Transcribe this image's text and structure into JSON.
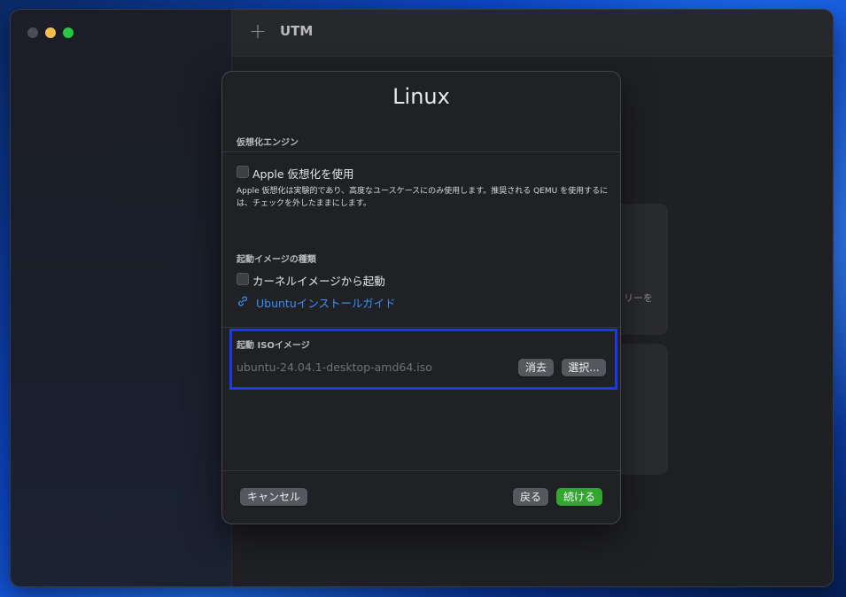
{
  "app": {
    "title": "UTM"
  },
  "dialog": {
    "title": "Linux",
    "virtualization": {
      "section_label": "仮想化エンジン",
      "checkbox_label": "Apple 仮想化を使用",
      "description": "Apple 仮想化は実験的であり、高度なユースケースにのみ使用します。推奨される QEMU を使用するには、チェックを外したままにします。"
    },
    "boot_image_type": {
      "section_label": "起動イメージの種類",
      "checkbox_label": "カーネルイメージから起動",
      "guide_link": "Ubuntuインストールガイド"
    },
    "boot_iso": {
      "section_label": "起動 ISOイメージ",
      "path": "ubuntu-24.04.1-desktop-amd64.iso",
      "clear_label": "消去",
      "choose_label": "選択..."
    },
    "footer": {
      "cancel_label": "キャンセル",
      "back_label": "戻る",
      "continue_label": "続ける"
    }
  },
  "background_card": {
    "partial_text": "リーを"
  },
  "colors": {
    "accent_link": "#3a8ff7",
    "primary_button": "#33a531",
    "highlight_border": "#1d37f0"
  }
}
